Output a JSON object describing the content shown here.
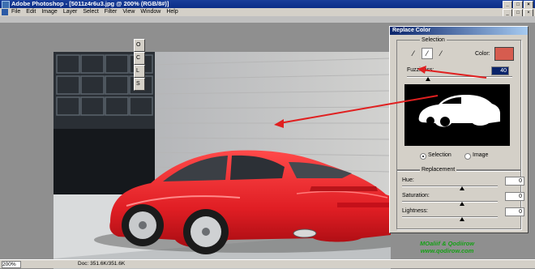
{
  "app": {
    "title": "Adobe Photoshop - [5011z4r6u3.jpg @ 200% (RGB/8#)]",
    "window_buttons": [
      "_",
      "□",
      "×"
    ]
  },
  "menu": {
    "items": [
      "File",
      "Edit",
      "Image",
      "Layer",
      "Select",
      "Filter",
      "View",
      "Window",
      "Help"
    ],
    "mdi_buttons": [
      "_",
      "□",
      "×"
    ]
  },
  "status": {
    "zoom": "200%",
    "doc": "Doc: 351.6K/351.6K"
  },
  "dialog": {
    "title": "Replace Color",
    "selection": {
      "group_label": "Selection",
      "color_label": "Color:",
      "color_value": "#d65c4f",
      "fuzziness_label": "Fuzziness:",
      "fuzziness_value": "40",
      "fuzziness_level": 0.2,
      "radio_selection": "Selection",
      "radio_image": "Image",
      "selected_radio": "Selection",
      "tools": [
        "eyedropper-icon",
        "eyedropper-plus-icon",
        "eyedropper-minus-icon"
      ]
    },
    "replacement": {
      "group_label": "Replacement",
      "hue_label": "Hue:",
      "hue_value": "0",
      "saturation_label": "Saturation:",
      "saturation_value": "0",
      "lightness_label": "Lightness:",
      "lightness_value": "0"
    },
    "side_buttons": [
      "O",
      "C",
      "L",
      "S"
    ]
  },
  "watermark": {
    "line1": "MOaliif & Qodiirow",
    "line2": "www.qodirow.com"
  },
  "colors": {
    "car": "#e3202a",
    "titlebar": "#0b2d87",
    "accent_arrow": "#e02020"
  }
}
